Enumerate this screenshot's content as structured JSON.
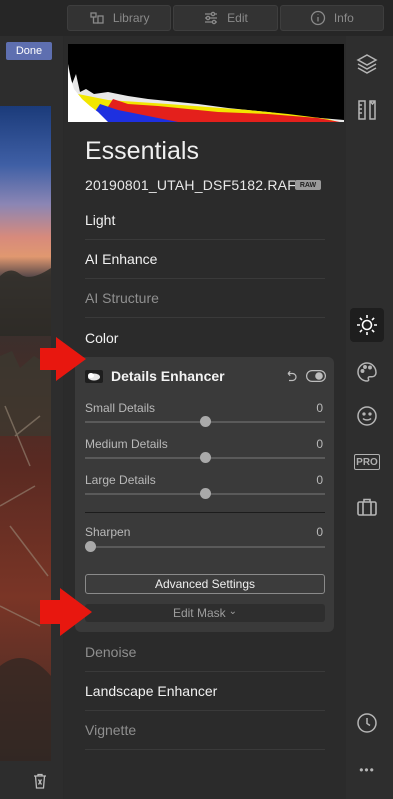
{
  "top_tabs": [
    {
      "label": "Library",
      "icon": "library-icon"
    },
    {
      "label": "Edit",
      "icon": "sliders-icon"
    },
    {
      "label": "Info",
      "icon": "info-icon"
    }
  ],
  "done_label": "Done",
  "panel": {
    "title": "Essentials",
    "filename": "20190801_UTAH_DSF5182.RAF",
    "file_badge": "RAW"
  },
  "sections_before": [
    {
      "label": "Light",
      "state": "active"
    },
    {
      "label": "AI Enhance",
      "state": "active"
    },
    {
      "label": "AI Structure",
      "state": "dim"
    },
    {
      "label": "Color",
      "state": "active"
    }
  ],
  "details_card": {
    "title": "Details Enhancer",
    "sliders": [
      {
        "label": "Small Details",
        "value": "0",
        "position": 0.5
      },
      {
        "label": "Medium Details",
        "value": "0",
        "position": 0.5
      },
      {
        "label": "Large Details",
        "value": "0",
        "position": 0.5
      },
      {
        "label": "Sharpen",
        "value": "0",
        "position": 0.0
      }
    ],
    "advanced_label": "Advanced Settings",
    "mask_label": "Edit Mask",
    "mask_chevron": "⌄"
  },
  "sections_after": [
    {
      "label": "Denoise",
      "state": "dim"
    },
    {
      "label": "Landscape Enhancer",
      "state": "active"
    },
    {
      "label": "Vignette",
      "state": "dim"
    }
  ],
  "right_rail": {
    "icons": [
      "layers-icon",
      "ruler-icon",
      "sun-icon",
      "palette-icon",
      "face-icon",
      "pro-icon",
      "briefcase-icon",
      "history-icon",
      "more-icon"
    ],
    "pro_label": "PRO",
    "more_label": "•••"
  },
  "colors": {
    "accent": "#5e6fb0",
    "arrow": "#e8170f"
  }
}
